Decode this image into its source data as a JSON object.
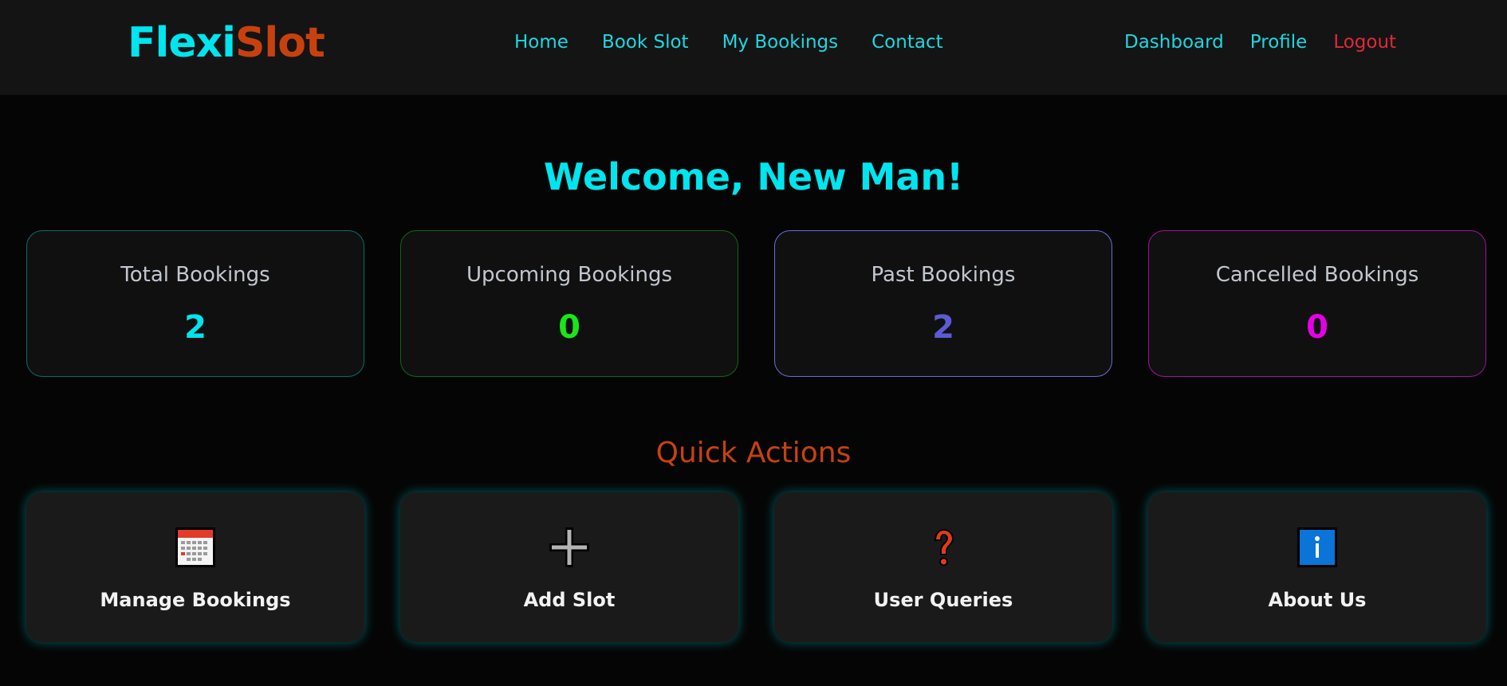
{
  "brand": {
    "part1": "Flexi",
    "part2": "Slot"
  },
  "nav": {
    "center": [
      "Home",
      "Book Slot",
      "My Bookings",
      "Contact"
    ],
    "right": [
      "Dashboard",
      "Profile",
      "Logout"
    ]
  },
  "welcome": "Welcome, New Man!",
  "stats": [
    {
      "label": "Total Bookings",
      "value": "2",
      "color": "#00e5ee",
      "border": "#0a6b6b"
    },
    {
      "label": "Upcoming Bookings",
      "value": "0",
      "color": "#19e619",
      "border": "#0f6a12"
    },
    {
      "label": "Past Bookings",
      "value": "2",
      "color": "#5b5bd6",
      "border": "#6b6be0"
    },
    {
      "label": "Cancelled Bookings",
      "value": "0",
      "color": "#e600e6",
      "border": "#a3109e"
    }
  ],
  "quick_actions": {
    "title": "Quick Actions",
    "items": [
      {
        "label": "Manage Bookings",
        "icon": "calendar-icon"
      },
      {
        "label": "Add Slot",
        "icon": "plus-icon"
      },
      {
        "label": "User Queries",
        "icon": "question-icon"
      },
      {
        "label": "About Us",
        "icon": "info-icon"
      }
    ]
  },
  "colors": {
    "accent": "#00e5ee",
    "brand_secondary": "#c7410f",
    "logout": "#e0293a",
    "background": "#050505",
    "navbar": "#141414"
  }
}
